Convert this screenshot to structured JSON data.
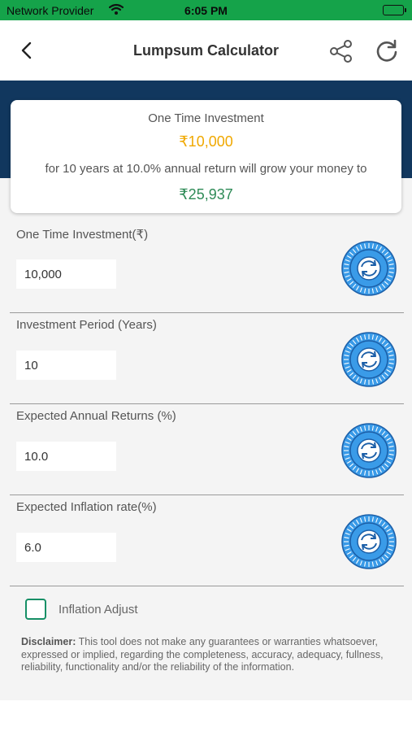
{
  "status_bar": {
    "carrier": "Network Provider",
    "time": "6:05 PM",
    "wifi_icon": "wifi-icon",
    "battery_icon": "battery-icon"
  },
  "nav": {
    "title": "Lumpsum Calculator",
    "back_icon": "back-chevron-icon",
    "share_icon": "share-icon",
    "refresh_icon": "refresh-icon"
  },
  "summary": {
    "label": "One Time Investment",
    "amount": "₹10,000",
    "description": "for 10 years at 10.0% annual return will grow your money to",
    "result": "₹25,937"
  },
  "fields": [
    {
      "label": "One Time Investment(₹)",
      "value": "10,000"
    },
    {
      "label": "Investment Period (Years)",
      "value": "10"
    },
    {
      "label": "Expected Annual Returns (%)",
      "value": "10.0"
    },
    {
      "label": "Expected Inflation rate(%)",
      "value": "6.0"
    }
  ],
  "inflation_adjust": {
    "label": "Inflation Adjust",
    "checked": false
  },
  "disclaimer": {
    "title": "Disclaimer:",
    "text": " This tool does not make any guarantees or warranties whatsoever, expressed or implied, regarding the completeness, accuracy, adequacy, fullness, reliability, functionality and/or the reliability of the information."
  },
  "colors": {
    "status_bar": "#15a34a",
    "header_band": "#11375e",
    "amount": "#f0a800",
    "result": "#2e8b57",
    "dial": "#3a9be8",
    "checkbox": "#168f66"
  }
}
